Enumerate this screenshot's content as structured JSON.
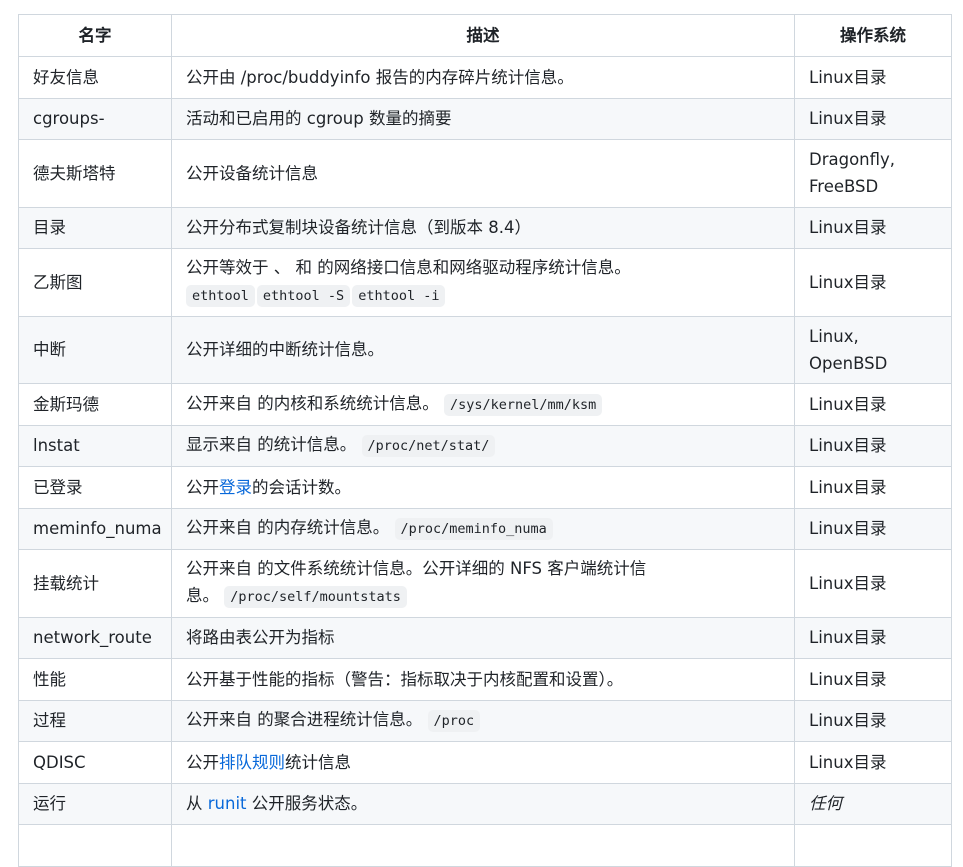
{
  "headers": {
    "name": "名字",
    "desc": "描述",
    "os": "操作系统"
  },
  "rows": [
    {
      "name": "好友信息",
      "desc": "公开由 /proc/buddyinfo 报告的内存碎片统计信息。",
      "os": "Linux目录"
    },
    {
      "name": "cgroups-",
      "desc": "活动和已启用的 cgroup 数量的摘要",
      "os": "Linux目录"
    },
    {
      "name": "德夫斯塔特",
      "desc": "公开设备统计信息",
      "os_line1": "Dragonfly,",
      "os_line2": "FreeBSD"
    },
    {
      "name": "目录",
      "desc": "公开分布式复制块设备统计信息（到版本 8.4）",
      "os": "Linux目录"
    },
    {
      "name": "乙斯图",
      "desc": "公开等效于 、 和 的网络接口信息和网络驱动程序统计信息。",
      "codes": [
        "ethtool",
        "ethtool -S",
        "ethtool -i"
      ],
      "os": "Linux目录"
    },
    {
      "name": "中断",
      "desc": "公开详细的中断统计信息。",
      "os_line1": "Linux,",
      "os_line2": "OpenBSD"
    },
    {
      "name": "金斯玛德",
      "desc": "公开来自 的内核和系统统计信息。",
      "code": "/sys/kernel/mm/ksm",
      "os": "Linux目录"
    },
    {
      "name": "lnstat",
      "desc": "显示来自 的统计信息。",
      "code": "/proc/net/stat/",
      "os": "Linux目录"
    },
    {
      "name": "已登录",
      "desc_pre": "公开",
      "link": "登录",
      "desc_post": "的会话计数。",
      "os": "Linux目录"
    },
    {
      "name": "meminfo_numa",
      "desc": "公开来自 的内存统计信息。",
      "code": "/proc/meminfo_numa",
      "os": "Linux目录"
    },
    {
      "name": "挂载统计",
      "desc_line1": "公开来自 的文件系统统计信息。公开详细的 NFS 客户端统计信",
      "desc_line2": "息。",
      "code": "/proc/self/mountstats",
      "os": "Linux目录"
    },
    {
      "name": "network_route",
      "desc": "将路由表公开为指标",
      "os": "Linux目录"
    },
    {
      "name": "性能",
      "desc": "公开基于性能的指标（警告：指标取决于内核配置和设置）。",
      "os": "Linux目录"
    },
    {
      "name": "过程",
      "desc": "公开来自 的聚合进程统计信息。",
      "code": "/proc",
      "os": "Linux目录"
    },
    {
      "name": "QDISC",
      "desc_pre": "公开",
      "link": "排队规则",
      "desc_post": "统计信息",
      "os": "Linux目录"
    },
    {
      "name": "运行",
      "desc_pre": "从 ",
      "link": "runit",
      "desc_post": " 公开服务状态。",
      "os": "任何"
    }
  ]
}
